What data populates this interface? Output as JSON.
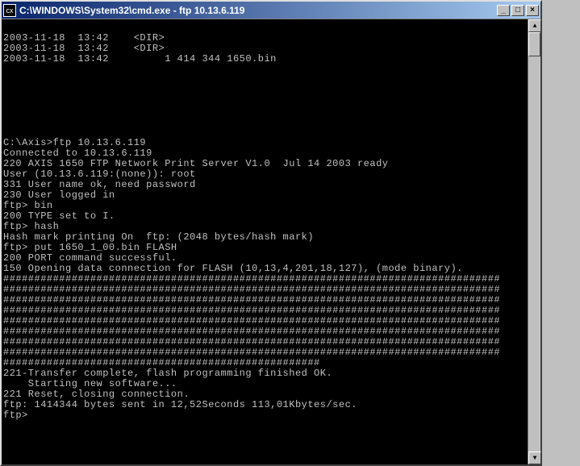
{
  "window": {
    "icon_label": "cx",
    "title": "C:\\WINDOWS\\System32\\cmd.exe - ftp 10.13.6.119",
    "buttons": {
      "minimize": "_",
      "maximize": "□",
      "close": "×"
    }
  },
  "scroll": {
    "up": "▲",
    "down": "▼"
  },
  "terminal": {
    "lines": [
      "",
      "2003-11-18  13:42    <DIR>",
      "2003-11-18  13:42    <DIR>",
      "2003-11-18  13:42         1 414 344 1650.bin",
      "",
      "",
      "",
      "",
      "",
      "",
      "",
      "C:\\Axis>ftp 10.13.6.119",
      "Connected to 10.13.6.119",
      "220 AXIS 1650 FTP Network Print Server V1.0  Jul 14 2003 ready",
      "User (10.13.6.119:(none)): root",
      "331 User name ok, need password",
      "230 User logged in",
      "ftp> bin",
      "200 TYPE set to I.",
      "ftp> hash",
      "Hash mark printing On  ftp: (2048 bytes/hash mark)",
      "ftp> put 1650_1_00.bin FLASH",
      "200 PORT command successful.",
      "150 Opening data connection for FLASH (10,13,4,201,18,127), (mode binary).",
      "################################################################################",
      "################################################################################",
      "################################################################################",
      "################################################################################",
      "################################################################################",
      "################################################################################",
      "################################################################################",
      "################################################################################",
      "###################################################",
      "221-Transfer complete, flash programming finished OK.",
      "    Starting new software...",
      "221 Reset, closing connection.",
      "ftp: 1414344 bytes sent in 12,52Seconds 113,01Kbytes/sec.",
      "ftp>"
    ]
  }
}
